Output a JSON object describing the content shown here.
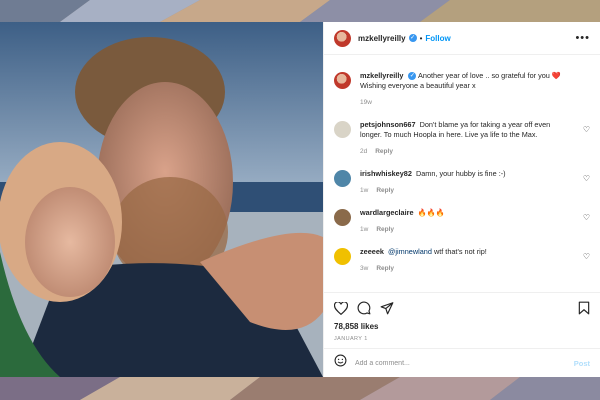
{
  "post_header": {
    "username": "mzkellyreilly",
    "separator": "•",
    "follow_label": "Follow",
    "more_label": "•••"
  },
  "caption": {
    "username": "mzkellyreilly",
    "text": "Another year of love .. so grateful for you ❤️ Wishing everyone a beautiful year x",
    "time": "19w"
  },
  "comments": [
    {
      "username": "petsjohnson667",
      "text": "Don't blame ya for taking a year off even longer. To much Hoopla in here. Live ya life to the Max.",
      "time": "2d",
      "reply": "Reply",
      "avatar_color": "#d9d4c7"
    },
    {
      "username": "irishwhiskey82",
      "text": "Damn, your hubby is fine :-)",
      "time": "1w",
      "reply": "Reply",
      "avatar_color": "#4f86a8"
    },
    {
      "username": "wardlargeclaire",
      "text": "🔥🔥🔥",
      "time": "1w",
      "reply": "Reply",
      "avatar_color": "#8a6a4a"
    },
    {
      "username": "zeeeek",
      "mention": "@jimnewland",
      "text": "wtf that's not rip!",
      "time": "3w",
      "reply": "Reply",
      "avatar_color": "#f0c000"
    }
  ],
  "likes": "78,858 likes",
  "date": "JANUARY 1",
  "add_comment": {
    "placeholder": "Add a comment...",
    "post_label": "Post"
  }
}
